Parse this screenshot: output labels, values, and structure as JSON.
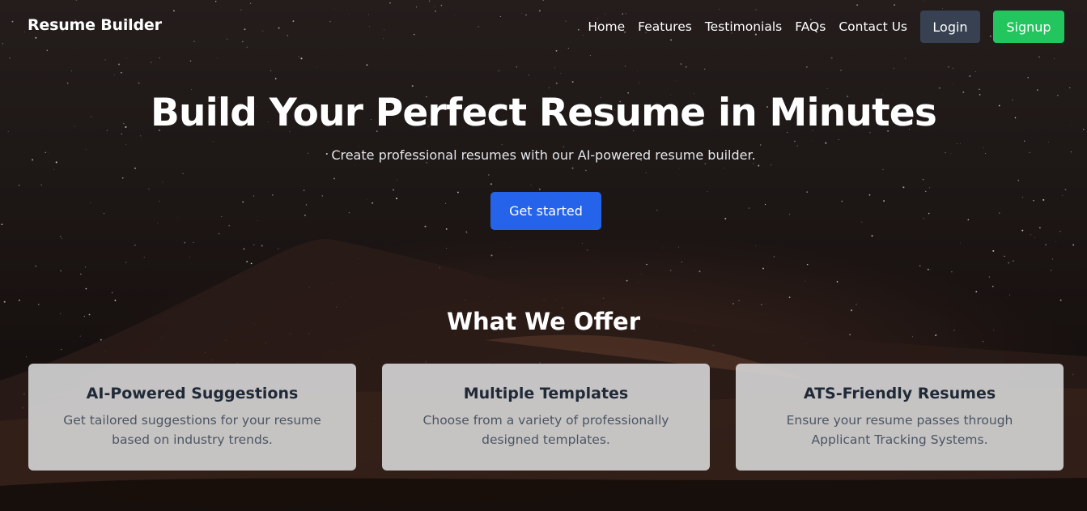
{
  "brand": "Resume Builder",
  "nav": {
    "links": [
      "Home",
      "Features",
      "Testimonials",
      "FAQs",
      "Contact Us"
    ],
    "login_label": "Login",
    "signup_label": "Signup"
  },
  "hero": {
    "title": "Build Your Perfect Resume in Minutes",
    "subtitle": "Create professional resumes with our AI-powered resume builder.",
    "cta_label": "Get started"
  },
  "offer": {
    "title": "What We Offer",
    "cards": [
      {
        "title": "AI-Powered Suggestions",
        "text": "Get tailored suggestions for your resume based on industry trends."
      },
      {
        "title": "Multiple Templates",
        "text": "Choose from a variety of professionally designed templates."
      },
      {
        "title": "ATS-Friendly Resumes",
        "text": "Ensure your resume passes through Applicant Tracking Systems."
      }
    ]
  },
  "colors": {
    "login_bg": "#374151",
    "signup_bg": "#22c55e",
    "cta_bg": "#2563eb",
    "card_title": "#1f2937",
    "card_text": "#4b5563"
  }
}
